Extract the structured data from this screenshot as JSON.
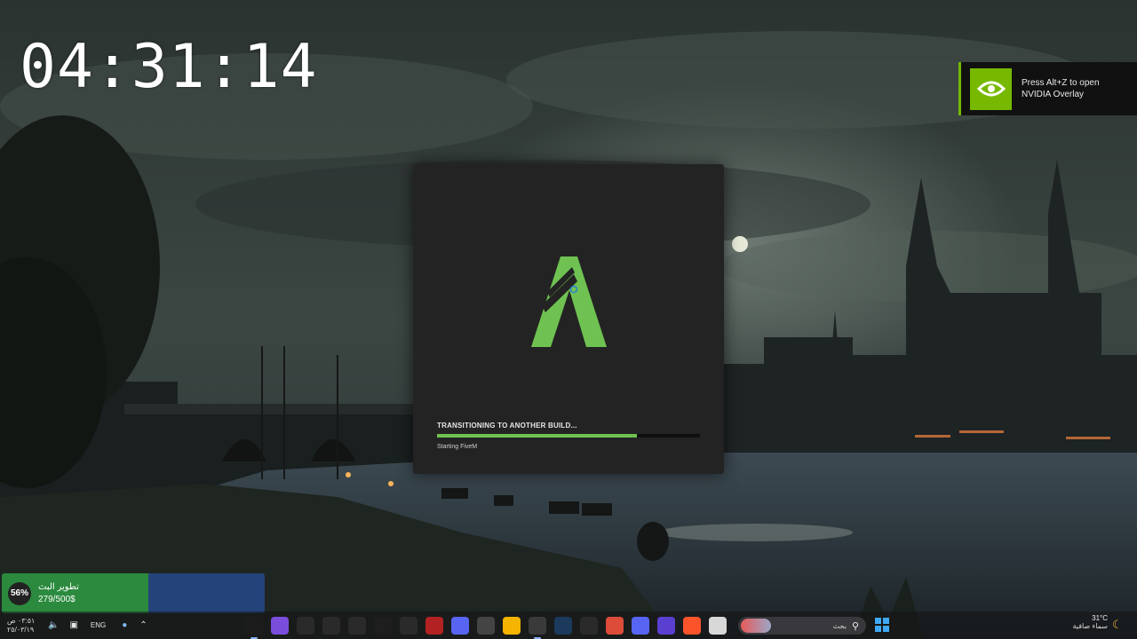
{
  "overlay": {
    "clock": "04:31:14"
  },
  "nvidia_toast": {
    "line1": "Press Alt+Z to open",
    "line2": "NVIDIA Overlay",
    "accent_color": "#76b900"
  },
  "fivem": {
    "status": "TRANSITIONING TO ANOTHER BUILD...",
    "substatus": "Starting FiveM",
    "progress": 0.76,
    "accent_color": "#6fc252"
  },
  "stream_goal": {
    "percent": "56%",
    "title": "تطوير البث",
    "amount": "279/500$",
    "progress": 0.56
  },
  "taskbar": {
    "time": "٠٣:٥١ ص",
    "date": "٢٥/٠٣/١٩",
    "language": "ENG",
    "search_placeholder": "بحث",
    "apps": [
      {
        "name": "obs",
        "color": "#1c1c1c"
      },
      {
        "name": "app-grid",
        "color": "#7b4ddb"
      },
      {
        "name": "alien-app",
        "color": "#2a2a2a"
      },
      {
        "name": "adobe-app",
        "color": "#2a2a2a"
      },
      {
        "name": "gear-app",
        "color": "#2a2a2a"
      },
      {
        "name": "fivem",
        "color": "#1e1e1e"
      },
      {
        "name": "kanji-app",
        "color": "#2a2a2a"
      },
      {
        "name": "red-app",
        "color": "#b22222"
      },
      {
        "name": "discord",
        "color": "#5865f2"
      },
      {
        "name": "cube-app",
        "color": "#444444"
      },
      {
        "name": "yellow-app",
        "color": "#f5b400"
      },
      {
        "name": "record-app",
        "color": "#3a3a3a"
      },
      {
        "name": "steam",
        "color": "#1b3a5c"
      },
      {
        "name": "mail-app",
        "color": "#2a2a2a"
      },
      {
        "name": "chrome",
        "color": "#dd4b39"
      },
      {
        "name": "discord-alt",
        "color": "#5865f2"
      },
      {
        "name": "media-app",
        "color": "#5b3fd1"
      },
      {
        "name": "brave",
        "color": "#fb542b"
      },
      {
        "name": "files-app",
        "color": "#d8d8d8"
      }
    ]
  },
  "weather": {
    "temp": "31°C",
    "desc": "سماء صافية"
  }
}
